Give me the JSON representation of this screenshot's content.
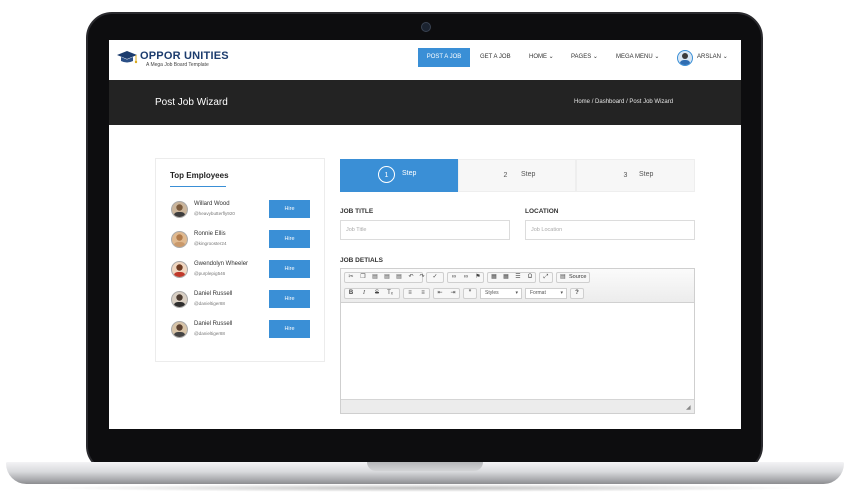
{
  "brand": {
    "name": "OPPOR UNITIES",
    "tagline": "A Mega Job Board Template"
  },
  "nav": {
    "post_job": "POST A JOB",
    "get_job": "GET A JOB",
    "home": "HOME",
    "pages": "PAGES",
    "mega_menu": "MEGA MENU",
    "user": "ARSLAN",
    "accent": "#3a8fd6"
  },
  "header": {
    "title": "Post Job Wizard",
    "breadcrumb": [
      "Home",
      "Dashboard",
      "Post Job Wizard"
    ]
  },
  "sidebar": {
    "title": "Top Employees",
    "employees": [
      {
        "name": "Willard Wood",
        "handle": "@heavybutterfly920",
        "action": "Hire"
      },
      {
        "name": "Ronnie Ellis",
        "handle": "@kingrooster24",
        "action": "Hire"
      },
      {
        "name": "Gwendolyn Wheeler",
        "handle": "@purplepig546",
        "action": "Hire"
      },
      {
        "name": "Daniel Russell",
        "handle": "@danieltiger88",
        "action": "Hire"
      },
      {
        "name": "Daniel Russell",
        "handle": "@danieltiger88",
        "action": "Hire"
      }
    ]
  },
  "steps": [
    {
      "number": "1",
      "label": "Step",
      "active": true
    },
    {
      "number": "2",
      "label": "Step",
      "active": false
    },
    {
      "number": "3",
      "label": "Step",
      "active": false
    }
  ],
  "form": {
    "job_title": {
      "label": "JOB TITLE",
      "placeholder": "Job Title"
    },
    "location": {
      "label": "LOCATION",
      "placeholder": "Job Location"
    },
    "job_details": {
      "label": "JOB DETIALS"
    }
  },
  "editor": {
    "source_label": "Source",
    "styles_label": "Styles",
    "format_label": "Format"
  }
}
